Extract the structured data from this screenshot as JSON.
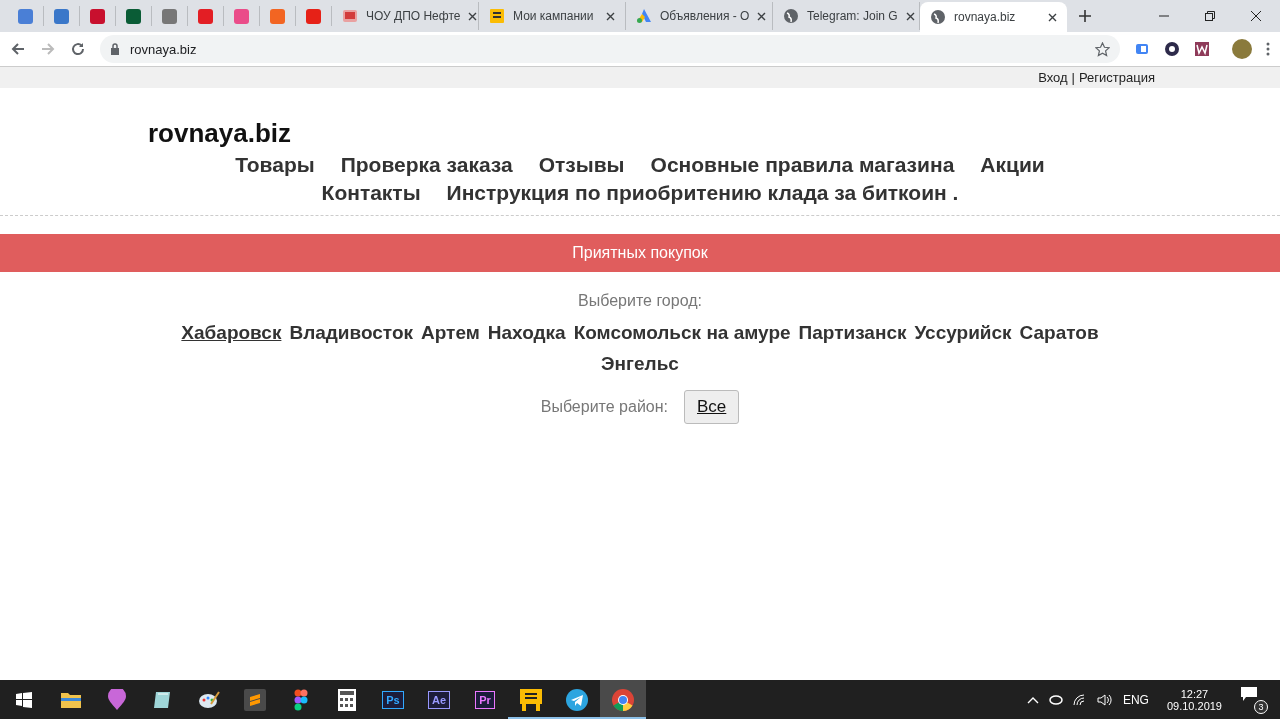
{
  "browser": {
    "tabs": [
      {
        "title": "ЧОУ ДПО Нефте",
        "selected": false,
        "kind": "book"
      },
      {
        "title": "Мои кампании",
        "selected": false,
        "kind": "yellow"
      },
      {
        "title": "Объявления - О",
        "selected": false,
        "kind": "ads"
      },
      {
        "title": "Telegram: Join G",
        "selected": false,
        "kind": "globe"
      },
      {
        "title": "rovnaya.biz",
        "selected": true,
        "kind": "globe"
      }
    ],
    "address": "rovnaya.biz"
  },
  "page": {
    "auth": {
      "login": "Вход",
      "separator": "|",
      "register": "Регистрация"
    },
    "logo": "rovnaya.biz",
    "nav": [
      "Товары",
      "Проверка заказа",
      "Отзывы",
      "Основные правила магазина",
      "Акции",
      "Контакты",
      "Инструкция по приобритению клада за биткоин ."
    ],
    "banner": "Приятных покупок",
    "city_label": "Выберите город:",
    "cities": [
      {
        "name": "Хабаровск",
        "selected": true
      },
      {
        "name": "Владивосток",
        "selected": false
      },
      {
        "name": "Артем",
        "selected": false
      },
      {
        "name": "Находка",
        "selected": false
      },
      {
        "name": "Комсомольск на амуре",
        "selected": false
      },
      {
        "name": "Партизанск",
        "selected": false
      },
      {
        "name": "Уссурийск",
        "selected": false
      },
      {
        "name": "Саратов",
        "selected": false
      },
      {
        "name": "Энгельс",
        "selected": false
      }
    ],
    "district_label": "Выберите район:",
    "district_button": "Все"
  },
  "taskbar": {
    "apps": [
      {
        "kind": "folder",
        "running": false,
        "selected": false
      },
      {
        "kind": "pin",
        "running": false,
        "selected": false
      },
      {
        "kind": "notepad",
        "running": false,
        "selected": false
      },
      {
        "kind": "paint",
        "running": false,
        "selected": false
      },
      {
        "kind": "sublime",
        "running": false,
        "selected": false
      },
      {
        "kind": "figma",
        "running": false,
        "selected": false
      },
      {
        "kind": "calc",
        "running": false,
        "selected": false
      },
      {
        "kind": "adobe",
        "label": "Ps",
        "color": "#31a8ff",
        "running": false,
        "selected": false
      },
      {
        "kind": "adobe",
        "label": "Ae",
        "color": "#9999ff",
        "running": false,
        "selected": false
      },
      {
        "kind": "adobe",
        "label": "Pr",
        "color": "#ea77ff",
        "running": false,
        "selected": false
      },
      {
        "kind": "yellow",
        "running": true,
        "selected": false
      },
      {
        "kind": "telegram",
        "running": true,
        "selected": false
      },
      {
        "kind": "chrome",
        "running": true,
        "selected": true
      }
    ],
    "language": "ENG",
    "time": "12:27",
    "date": "09.10.2019",
    "notifications": "3"
  }
}
